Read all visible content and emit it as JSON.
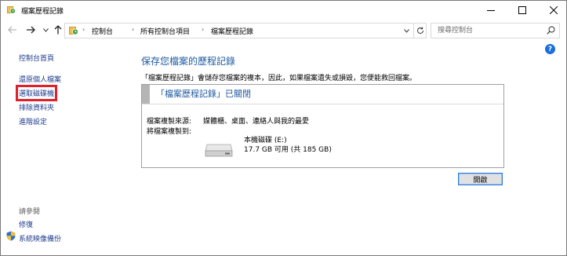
{
  "window": {
    "title": "檔案歷程記錄",
    "icons": {
      "app": "file-history-icon",
      "minimize": "minimize-icon",
      "maximize": "maximize-icon",
      "close": "close-icon"
    }
  },
  "navbar": {
    "breadcrumbs": [
      "控制台",
      "所有控制台項目",
      "檔案歷程記錄"
    ],
    "search_placeholder": "搜尋控制台",
    "icons": {
      "back": "arrow-left-icon",
      "forward": "arrow-right-icon",
      "recent": "chevron-down-icon",
      "up": "arrow-up-icon",
      "refresh": "refresh-icon",
      "search": "search-icon"
    }
  },
  "sidebar": {
    "home": "控制台首頁",
    "links": [
      "還原個人檔案",
      "選取磁碟機",
      "排除資料夾",
      "進階設定"
    ],
    "selected_link": "選取磁碟機",
    "see_also_header": "請參閱",
    "see_also": [
      "修復",
      "系統映像備份"
    ]
  },
  "main": {
    "heading": "保存您檔案的歷程記錄",
    "description": "「檔案歷程記錄」會儲存您檔案的複本，因此，如果檔案遺失或損毀，您便能救回檔案。",
    "status_title": "「檔案歷程記錄」已關閉",
    "copy_from_label": "檔案複製來源:",
    "copy_from_value": "媒體櫃、桌面、連絡人與我的最愛",
    "copy_to_label": "將檔案複製到:",
    "drive_name": "本機磁碟 (E:)",
    "drive_space": "17.7 GB 可用 (共 185 GB)",
    "turn_on_button": "開啟"
  },
  "colors": {
    "link": "#1c3b8b",
    "heading": "#1e5aa0",
    "highlight_box": "#e0202a",
    "help": "#1a6fd8"
  }
}
